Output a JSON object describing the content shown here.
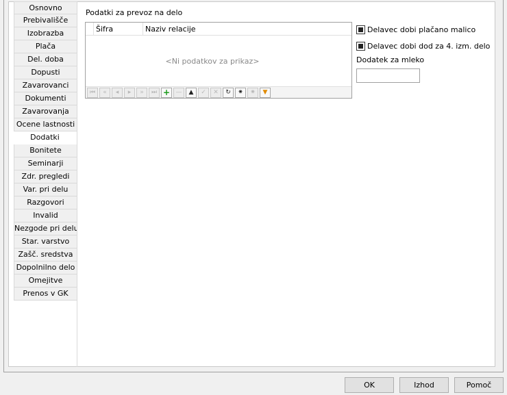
{
  "tabs": [
    {
      "label": "Osnovno",
      "active": false
    },
    {
      "label": "Prebivališče",
      "active": false
    },
    {
      "label": "Izobrazba",
      "active": false
    },
    {
      "label": "Plača",
      "active": false
    },
    {
      "label": "Del. doba",
      "active": false
    },
    {
      "label": "Dopusti",
      "active": false
    },
    {
      "label": "Zavarovanci",
      "active": false
    },
    {
      "label": "Dokumenti",
      "active": false
    },
    {
      "label": "Zavarovanja",
      "active": false
    },
    {
      "label": "Ocene lastnosti",
      "active": false
    },
    {
      "label": "Dodatki",
      "active": true
    },
    {
      "label": "Bonitete",
      "active": false
    },
    {
      "label": "Seminarji",
      "active": false
    },
    {
      "label": "Zdr. pregledi",
      "active": false
    },
    {
      "label": "Var. pri delu",
      "active": false
    },
    {
      "label": "Razgovori",
      "active": false
    },
    {
      "label": "Invalid",
      "active": false
    },
    {
      "label": "Nezgode pri delu",
      "active": false
    },
    {
      "label": "Star. varstvo",
      "active": false
    },
    {
      "label": "Zašč. sredstva",
      "active": false
    },
    {
      "label": "Dopolnilno delo",
      "active": false
    },
    {
      "label": "Omejitve",
      "active": false
    },
    {
      "label": "Prenos v GK",
      "active": false
    }
  ],
  "section": {
    "title": "Podatki za prevoz na delo"
  },
  "grid": {
    "columns": [
      "Šifra",
      "Naziv relacije"
    ],
    "empty_text": "<Ni podatkov za prikaz>"
  },
  "navigator": [
    {
      "icon": "first-record-icon",
      "glyph": "⏮",
      "enabled": false
    },
    {
      "icon": "prev-page-icon",
      "glyph": "«",
      "enabled": false
    },
    {
      "icon": "prev-record-icon",
      "glyph": "◂",
      "enabled": false
    },
    {
      "icon": "next-record-icon",
      "glyph": "▸",
      "enabled": false
    },
    {
      "icon": "next-page-icon",
      "glyph": "»",
      "enabled": false
    },
    {
      "icon": "last-record-icon",
      "glyph": "⏭",
      "enabled": false
    },
    {
      "icon": "add-icon",
      "glyph": "+",
      "enabled": true
    },
    {
      "icon": "delete-icon",
      "glyph": "—",
      "enabled": false
    },
    {
      "icon": "edit-icon",
      "glyph": "▲",
      "enabled": true
    },
    {
      "icon": "post-icon",
      "glyph": "✓",
      "enabled": false
    },
    {
      "icon": "cancel-icon",
      "glyph": "✕",
      "enabled": false
    },
    {
      "icon": "refresh-icon",
      "glyph": "↻",
      "enabled": true
    },
    {
      "icon": "bookmark-icon",
      "glyph": "✷",
      "enabled": true
    },
    {
      "icon": "goto-bookmark-icon",
      "glyph": "✷",
      "enabled": false
    },
    {
      "icon": "filter-icon",
      "glyph": "▼",
      "enabled": true
    }
  ],
  "options": {
    "malica_label": "Delavec dobi plačano malico",
    "malica_checked": true,
    "izmena_label": "Delavec dobi dod za 4. izm. delo",
    "izmena_checked": true,
    "mleko_label": "Dodatek za mleko",
    "mleko_value": ""
  },
  "buttons": {
    "ok": "OK",
    "izhod": "Izhod",
    "pomoc": "Pomoč"
  }
}
